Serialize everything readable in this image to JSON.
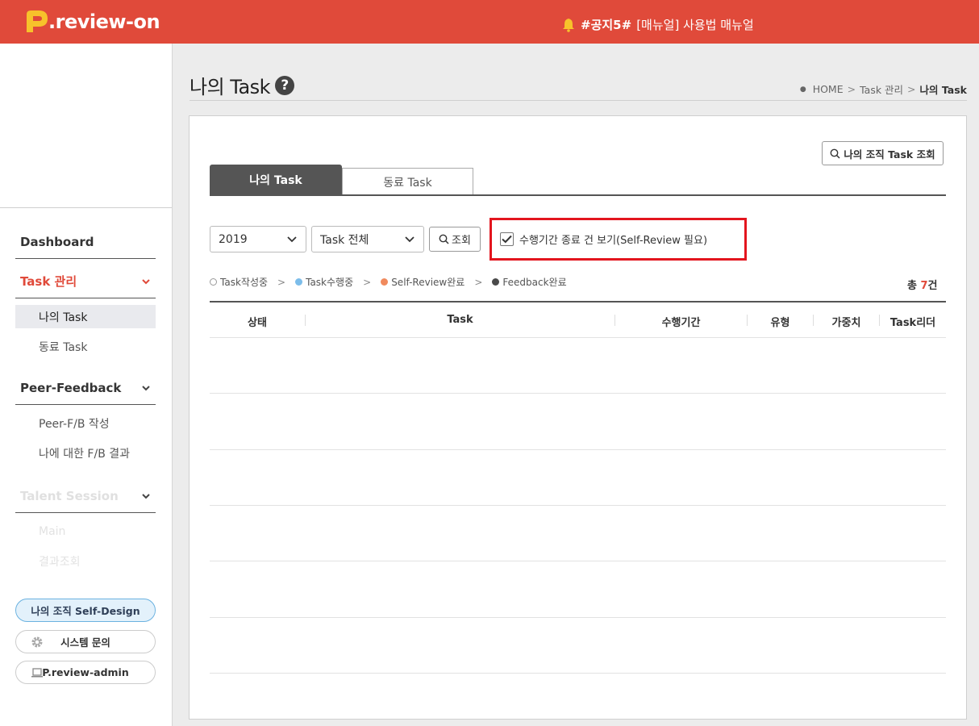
{
  "header": {
    "logo_text": ".review-on",
    "notice_tag": "#공지5#",
    "notice_text": "[매뉴얼] 사용법 매뉴얼",
    "brand_color": "#e04a3a"
  },
  "sidebar": {
    "dashboard": "Dashboard",
    "task_mgmt": "Task 관리",
    "task_items": [
      "나의 Task",
      "동료 Task"
    ],
    "peer_feedback": "Peer-Feedback",
    "peer_items": [
      "Peer-F/B 작성",
      "나에 대한 F/B 결과"
    ],
    "talent_session": "Talent Session",
    "talent_items": [
      "Main",
      "결과조회"
    ],
    "btn_self_design": "나의 조직 Self-Design",
    "btn_system_inquiry": "시스템 문의",
    "btn_admin": "P.review-admin"
  },
  "page": {
    "title": "나의 Task",
    "help_icon": "?",
    "breadcrumb": [
      "HOME",
      "Task 관리",
      "나의 Task"
    ]
  },
  "main": {
    "org_task_button": "나의 조직 Task 조회",
    "tabs": [
      {
        "label": "나의 Task",
        "active": true
      },
      {
        "label": "동료 Task",
        "active": false
      }
    ],
    "year_select": "2019",
    "task_filter_select": "Task 전체",
    "search_button": "조회",
    "checkbox_label": "수행기간 종료 건 보기(Self-Review 필요)",
    "checkbox_checked": true,
    "legend": [
      {
        "label": "Task작성중",
        "color": "#ffffff",
        "border": "#999999"
      },
      {
        "label": "Task수행중",
        "color": "#7cbdea",
        "border": "#7cbdea"
      },
      {
        "label": "Self-Review완료",
        "color": "#f08a5d",
        "border": "#f08a5d"
      },
      {
        "label": "Feedback완료",
        "color": "#4a4a4a",
        "border": "#4a4a4a"
      }
    ],
    "count_prefix": "총 ",
    "count_value": "7",
    "count_suffix": "건",
    "columns": [
      "상태",
      "Task",
      "수행기간",
      "유형",
      "가중치",
      "Task리더"
    ]
  }
}
